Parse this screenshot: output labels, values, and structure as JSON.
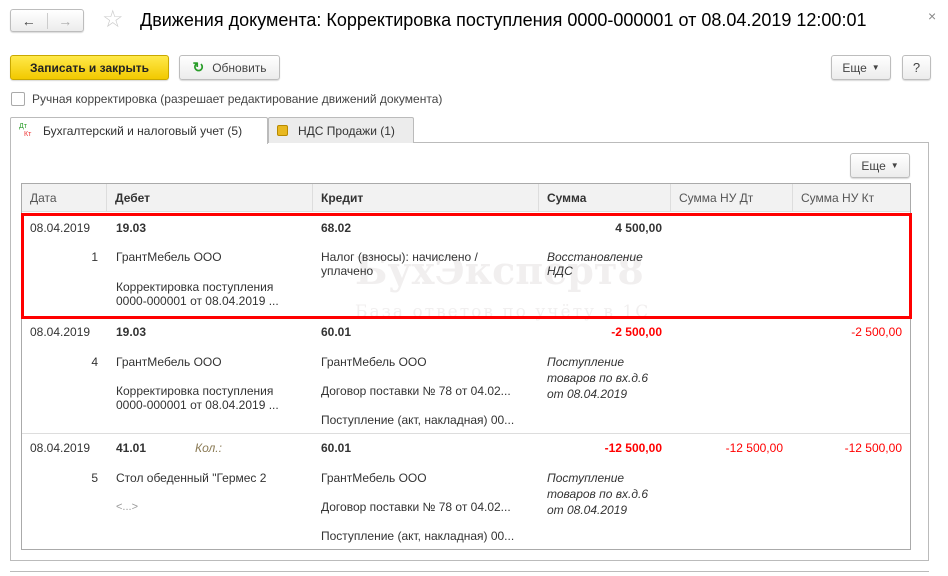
{
  "window": {
    "title": "Движения документа: Корректировка поступления 0000-000001 от 08.04.2019 12:00:01",
    "close": "×"
  },
  "toolbar": {
    "save_close": "Записать и закрыть",
    "refresh": "Обновить",
    "more": "Еще",
    "help": "?"
  },
  "manual": {
    "label": "Ручная корректировка (разрешает редактирование движений документа)",
    "checked": false
  },
  "tabs": [
    {
      "label": "Бухгалтерский и налоговый учет (5)",
      "icon_top": "Дт",
      "icon_bottom": "Кт",
      "active": true
    },
    {
      "label": "НДС Продажи (1)",
      "active": false
    }
  ],
  "table": {
    "more": "Еще",
    "columns": [
      "Дата",
      "Дебет",
      "Кредит",
      "Сумма",
      "Сумма НУ Дт",
      "Сумма НУ Кт"
    ],
    "rows": [
      {
        "date": "08.04.2019",
        "num": "1",
        "debit": "19.03",
        "debit_sub": [
          "ГрантМебель ООО",
          "Корректировка поступления",
          "0000-000001 от 08.04.2019 ..."
        ],
        "debit_extra": "",
        "credit": "68.02",
        "credit_sub": [
          "Налог (взносы): начислено /",
          "уплачено"
        ],
        "sum": "4 500,00",
        "content": [
          "Восстановление",
          "НДС"
        ],
        "nu_dt": "",
        "nu_kt": "",
        "highlighted": true
      },
      {
        "date": "08.04.2019",
        "num": "4",
        "debit": "19.03",
        "debit_sub": [
          "ГрантМебель ООО",
          "Корректировка поступления",
          "0000-000001 от 08.04.2019 ..."
        ],
        "debit_extra": "",
        "credit": "60.01",
        "credit_sub": [
          "ГрантМебель ООО",
          "Договор поставки № 78 от 04.02...",
          "Поступление (акт, накладная) 00..."
        ],
        "sum": "-2 500,00",
        "content": [
          "Поступление",
          "товаров по вх.д.6",
          "от 08.04.2019"
        ],
        "nu_dt": "",
        "nu_kt": "-2 500,00"
      },
      {
        "date": "08.04.2019",
        "num": "5",
        "debit": "41.01",
        "debit_qty": "Кол.:",
        "debit_sub": [
          "Стол обеденный \"Гермес 2",
          "<...>"
        ],
        "credit": "60.01",
        "credit_sub": [
          "ГрантМебель ООО",
          "Договор поставки № 78 от 04.02...",
          "Поступление (акт, накладная) 00..."
        ],
        "sum": "-12 500,00",
        "content": [
          "Поступление",
          "товаров по вх.д.6",
          "от 08.04.2019"
        ],
        "nu_dt": "-12 500,00",
        "nu_kt": "-12 500,00"
      }
    ]
  },
  "watermark": {
    "brand": "БухЭксперт8",
    "tagline": "База ответов по учёту в 1С"
  },
  "colors": {
    "primary": "#f7d117",
    "negative": "#ff0000",
    "highlight": "#ff0000"
  }
}
